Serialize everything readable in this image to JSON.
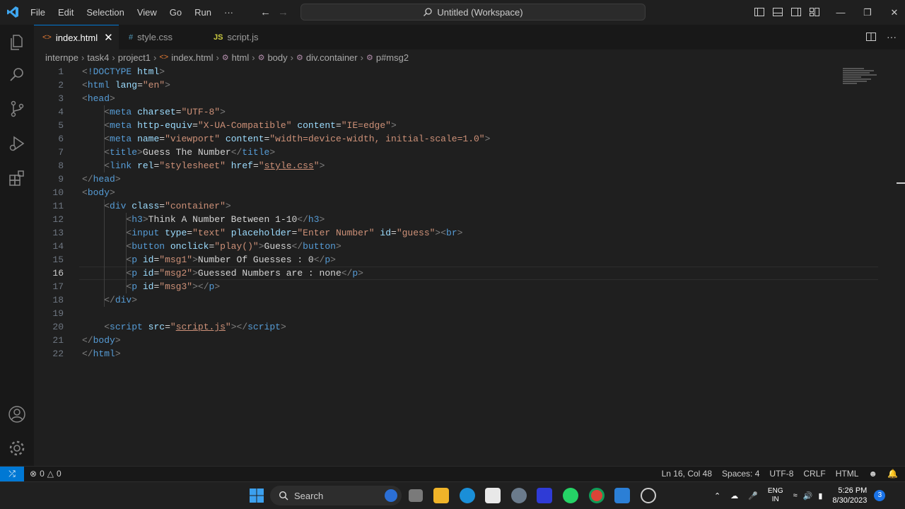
{
  "menu": [
    "File",
    "Edit",
    "Selection",
    "View",
    "Go",
    "Run",
    "···"
  ],
  "command_center": "Untitled (Workspace)",
  "tabs": [
    {
      "label": "index.html",
      "icon": "<>",
      "active": true
    },
    {
      "label": "style.css",
      "icon": "#",
      "active": false
    },
    {
      "label": "script.js",
      "icon": "JS",
      "active": false
    }
  ],
  "breadcrumbs": [
    "internpe",
    "task4",
    "project1",
    "index.html",
    "html",
    "body",
    "div.container",
    "p#msg2"
  ],
  "editor": {
    "current_line": 16,
    "lines": [
      [
        [
          "t",
          "<"
        ],
        [
          "tg",
          "!DOCTYPE"
        ],
        [
          "tx",
          " "
        ],
        [
          "at",
          "html"
        ],
        [
          "t",
          ">"
        ]
      ],
      [
        [
          "t",
          "<"
        ],
        [
          "tg",
          "html"
        ],
        [
          "tx",
          " "
        ],
        [
          "at",
          "lang"
        ],
        [
          "tx",
          "="
        ],
        [
          "st",
          "\"en\""
        ],
        [
          "t",
          ">"
        ]
      ],
      [
        [
          "t",
          "<"
        ],
        [
          "tg",
          "head"
        ],
        [
          "t",
          ">"
        ]
      ],
      [
        [
          "tx",
          "    "
        ],
        [
          "t",
          "<"
        ],
        [
          "tg",
          "meta"
        ],
        [
          "tx",
          " "
        ],
        [
          "at",
          "charset"
        ],
        [
          "tx",
          "="
        ],
        [
          "st",
          "\"UTF-8\""
        ],
        [
          "t",
          ">"
        ]
      ],
      [
        [
          "tx",
          "    "
        ],
        [
          "t",
          "<"
        ],
        [
          "tg",
          "meta"
        ],
        [
          "tx",
          " "
        ],
        [
          "at",
          "http-equiv"
        ],
        [
          "tx",
          "="
        ],
        [
          "st",
          "\"X-UA-Compatible\""
        ],
        [
          "tx",
          " "
        ],
        [
          "at",
          "content"
        ],
        [
          "tx",
          "="
        ],
        [
          "st",
          "\"IE=edge\""
        ],
        [
          "t",
          ">"
        ]
      ],
      [
        [
          "tx",
          "    "
        ],
        [
          "t",
          "<"
        ],
        [
          "tg",
          "meta"
        ],
        [
          "tx",
          " "
        ],
        [
          "at",
          "name"
        ],
        [
          "tx",
          "="
        ],
        [
          "st",
          "\"viewport\""
        ],
        [
          "tx",
          " "
        ],
        [
          "at",
          "content"
        ],
        [
          "tx",
          "="
        ],
        [
          "st",
          "\"width=device-width, initial-scale=1.0\""
        ],
        [
          "t",
          ">"
        ]
      ],
      [
        [
          "tx",
          "    "
        ],
        [
          "t",
          "<"
        ],
        [
          "tg",
          "title"
        ],
        [
          "t",
          ">"
        ],
        [
          "tx",
          "Guess The Number"
        ],
        [
          "t",
          "</"
        ],
        [
          "tg",
          "title"
        ],
        [
          "t",
          ">"
        ]
      ],
      [
        [
          "tx",
          "    "
        ],
        [
          "t",
          "<"
        ],
        [
          "tg",
          "link"
        ],
        [
          "tx",
          " "
        ],
        [
          "at",
          "rel"
        ],
        [
          "tx",
          "="
        ],
        [
          "st",
          "\"stylesheet\""
        ],
        [
          "tx",
          " "
        ],
        [
          "at",
          "href"
        ],
        [
          "tx",
          "="
        ],
        [
          "st",
          "\""
        ],
        [
          "st ul",
          "style.css"
        ],
        [
          "st",
          "\""
        ],
        [
          "t",
          ">"
        ]
      ],
      [
        [
          "t",
          "</"
        ],
        [
          "tg",
          "head"
        ],
        [
          "t",
          ">"
        ]
      ],
      [
        [
          "t",
          "<"
        ],
        [
          "tg",
          "body"
        ],
        [
          "t",
          ">"
        ]
      ],
      [
        [
          "tx",
          "    "
        ],
        [
          "t",
          "<"
        ],
        [
          "tg",
          "div"
        ],
        [
          "tx",
          " "
        ],
        [
          "at",
          "class"
        ],
        [
          "tx",
          "="
        ],
        [
          "st",
          "\"container\""
        ],
        [
          "t",
          ">"
        ]
      ],
      [
        [
          "tx",
          "        "
        ],
        [
          "t",
          "<"
        ],
        [
          "tg",
          "h3"
        ],
        [
          "t",
          ">"
        ],
        [
          "tx",
          "Think A Number Between 1-10"
        ],
        [
          "t",
          "</"
        ],
        [
          "tg",
          "h3"
        ],
        [
          "t",
          ">"
        ]
      ],
      [
        [
          "tx",
          "        "
        ],
        [
          "t",
          "<"
        ],
        [
          "tg",
          "input"
        ],
        [
          "tx",
          " "
        ],
        [
          "at",
          "type"
        ],
        [
          "tx",
          "="
        ],
        [
          "st",
          "\"text\""
        ],
        [
          "tx",
          " "
        ],
        [
          "at",
          "placeholder"
        ],
        [
          "tx",
          "="
        ],
        [
          "st",
          "\"Enter Number\""
        ],
        [
          "tx",
          " "
        ],
        [
          "at",
          "id"
        ],
        [
          "tx",
          "="
        ],
        [
          "st",
          "\"guess\""
        ],
        [
          "t",
          ">"
        ],
        [
          "t",
          "<"
        ],
        [
          "tg",
          "br"
        ],
        [
          "t",
          ">"
        ]
      ],
      [
        [
          "tx",
          "        "
        ],
        [
          "t",
          "<"
        ],
        [
          "tg",
          "button"
        ],
        [
          "tx",
          " "
        ],
        [
          "at",
          "onclick"
        ],
        [
          "tx",
          "="
        ],
        [
          "st",
          "\"play()\""
        ],
        [
          "t",
          ">"
        ],
        [
          "tx",
          "Guess"
        ],
        [
          "t",
          "</"
        ],
        [
          "tg",
          "button"
        ],
        [
          "t",
          ">"
        ]
      ],
      [
        [
          "tx",
          "        "
        ],
        [
          "t",
          "<"
        ],
        [
          "tg",
          "p"
        ],
        [
          "tx",
          " "
        ],
        [
          "at",
          "id"
        ],
        [
          "tx",
          "="
        ],
        [
          "st",
          "\"msg1\""
        ],
        [
          "t",
          ">"
        ],
        [
          "tx",
          "Number Of Guesses : 0"
        ],
        [
          "t",
          "</"
        ],
        [
          "tg",
          "p"
        ],
        [
          "t",
          ">"
        ]
      ],
      [
        [
          "tx",
          "        "
        ],
        [
          "t",
          "<"
        ],
        [
          "tg",
          "p"
        ],
        [
          "tx",
          " "
        ],
        [
          "at",
          "id"
        ],
        [
          "tx",
          "="
        ],
        [
          "st",
          "\"msg2\""
        ],
        [
          "t",
          ">"
        ],
        [
          "tx",
          "Guessed Numbers are : none"
        ],
        [
          "t",
          "</"
        ],
        [
          "tg",
          "p"
        ],
        [
          "t",
          ">"
        ]
      ],
      [
        [
          "tx",
          "        "
        ],
        [
          "t",
          "<"
        ],
        [
          "tg",
          "p"
        ],
        [
          "tx",
          " "
        ],
        [
          "at",
          "id"
        ],
        [
          "tx",
          "="
        ],
        [
          "st",
          "\"msg3\""
        ],
        [
          "t",
          "></"
        ],
        [
          "tg",
          "p"
        ],
        [
          "t",
          ">"
        ]
      ],
      [
        [
          "tx",
          "    "
        ],
        [
          "t",
          "</"
        ],
        [
          "tg",
          "div"
        ],
        [
          "t",
          ">"
        ]
      ],
      [],
      [
        [
          "tx",
          "    "
        ],
        [
          "t",
          "<"
        ],
        [
          "tg",
          "script"
        ],
        [
          "tx",
          " "
        ],
        [
          "at",
          "src"
        ],
        [
          "tx",
          "="
        ],
        [
          "st",
          "\""
        ],
        [
          "st ul",
          "script.js"
        ],
        [
          "st",
          "\""
        ],
        [
          "t",
          "></"
        ],
        [
          "tg",
          "script"
        ],
        [
          "t",
          ">"
        ]
      ],
      [
        [
          "t",
          "</"
        ],
        [
          "tg",
          "body"
        ],
        [
          "t",
          ">"
        ]
      ],
      [
        [
          "t",
          "</"
        ],
        [
          "tg",
          "html"
        ],
        [
          "t",
          ">"
        ]
      ]
    ]
  },
  "status": {
    "errors": "0",
    "warnings": "0",
    "cursor": "Ln 16, Col 48",
    "spaces": "Spaces: 4",
    "encoding": "UTF-8",
    "eol": "CRLF",
    "language": "HTML"
  },
  "taskbar": {
    "search_label": "Search",
    "lang_top": "ENG",
    "lang_bottom": "IN",
    "time": "5:26 PM",
    "date": "8/30/2023",
    "notification_count": "3"
  },
  "colors": {
    "accent": "#0078d4",
    "tag": "#569cd6",
    "attr": "#9cdcfe",
    "string": "#ce9178"
  }
}
